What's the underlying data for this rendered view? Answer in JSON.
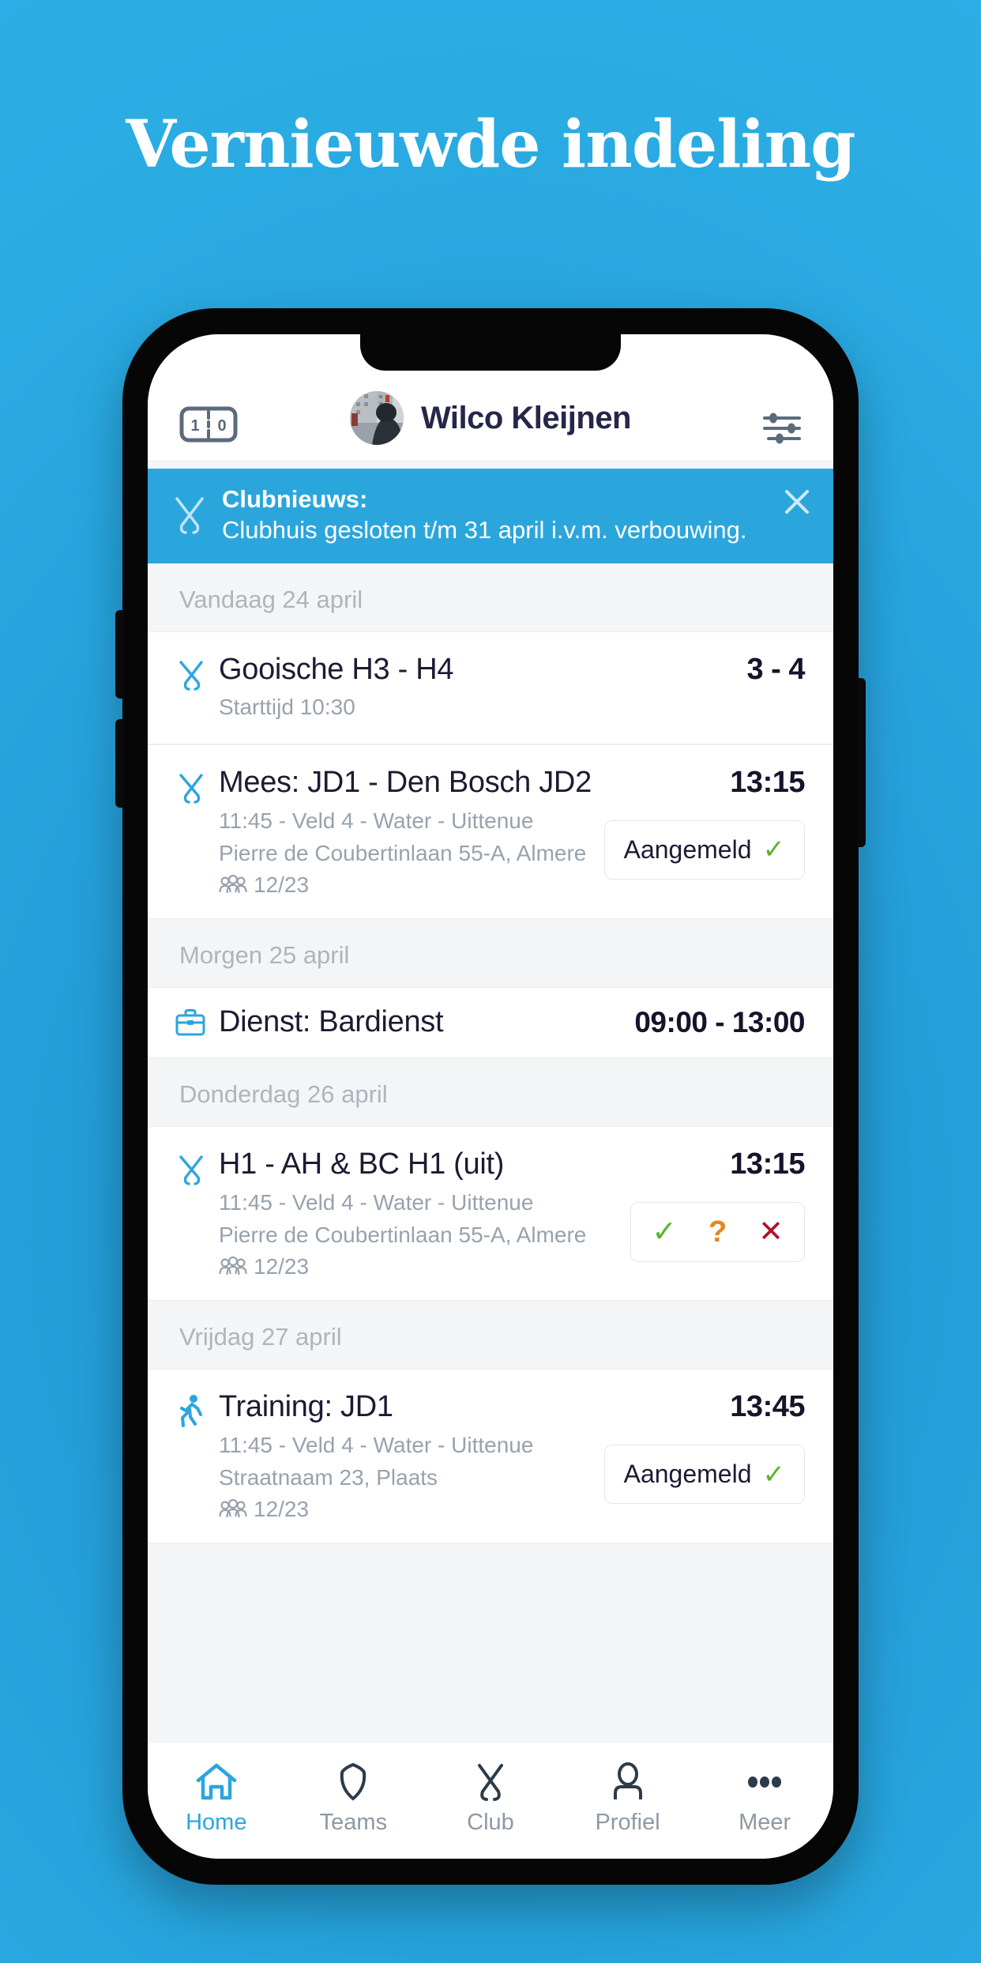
{
  "headline": "Vernieuwde indeling",
  "colors": {
    "background_blue": "#2aabe2",
    "accent_blue": "#2ba6dd",
    "text_dark": "#1b1b33",
    "text_muted": "#98a2ad",
    "yes_green": "#5cb531",
    "maybe_orange": "#e8861e",
    "no_red": "#b01228"
  },
  "app": {
    "header": {
      "scoreboard_icon": "scoreboard-icon",
      "scoreboard_left": "1",
      "scoreboard_right": "0",
      "avatar_icon": "avatar-photo",
      "user_name": "Wilco Kleijnen",
      "settings_icon": "sliders-icon"
    },
    "news_banner": {
      "icon": "crossed-hockey-sticks-icon",
      "title": "Clubnieuws:",
      "body": "Clubhuis gesloten t/m 31 april i.v.m. verbouwing.",
      "close_icon": "close-icon"
    },
    "agenda": [
      {
        "day_label": "Vandaag 24 april",
        "events": [
          {
            "icon": "hockey-sticks-icon",
            "title": "Gooische H3 - H4",
            "sub1": "Starttijd 10:30",
            "right_value": "3 - 4",
            "status": null
          }
        ]
      },
      {
        "day_label": "",
        "events": [
          {
            "icon": "hockey-sticks-icon",
            "title": "Mees: JD1 - Den Bosch JD2",
            "sub1": "11:45 - Veld 4 - Water - Uittenue",
            "sub2": "Pierre de Coubertinlaan 55-A, Almere",
            "people_icon": "people-icon",
            "people_count": "12/23",
            "right_value": "13:15",
            "status": {
              "type": "confirmed",
              "label": "Aangemeld",
              "check": "✓"
            }
          }
        ]
      },
      {
        "day_label": "Morgen 25 april",
        "events": [
          {
            "icon": "briefcase-icon",
            "title": "Dienst: Bardienst",
            "right_value": "09:00 - 13:00",
            "status": null
          }
        ]
      },
      {
        "day_label": "Donderdag 26 april",
        "events": [
          {
            "icon": "hockey-sticks-icon",
            "title": "H1 - AH & BC H1 (uit)",
            "sub1": "11:45 - Veld 4 - Water - Uittenue",
            "sub2": "Pierre de Coubertinlaan 55-A, Almere",
            "people_icon": "people-icon",
            "people_count": "12/23",
            "right_value": "13:15",
            "status": {
              "type": "choice",
              "yes": "✓",
              "maybe": "?",
              "no": "✕"
            }
          }
        ]
      },
      {
        "day_label": "Vrijdag 27 april",
        "events": [
          {
            "icon": "running-icon",
            "title": "Training: JD1",
            "sub1": "11:45 - Veld 4 - Water - Uittenue",
            "sub2": "Straatnaam 23, Plaats",
            "people_icon": "people-icon",
            "people_count": "12/23",
            "right_value": "13:45",
            "status": {
              "type": "confirmed",
              "label": "Aangemeld",
              "check": "✓"
            }
          }
        ]
      }
    ],
    "bottom_nav": [
      {
        "icon": "home-icon",
        "label": "Home",
        "active": true
      },
      {
        "icon": "shield-icon",
        "label": "Teams",
        "active": false
      },
      {
        "icon": "sticks-icon",
        "label": "Club",
        "active": false
      },
      {
        "icon": "person-icon",
        "label": "Profiel",
        "active": false
      },
      {
        "icon": "dots-icon",
        "label": "Meer",
        "active": false
      }
    ]
  }
}
